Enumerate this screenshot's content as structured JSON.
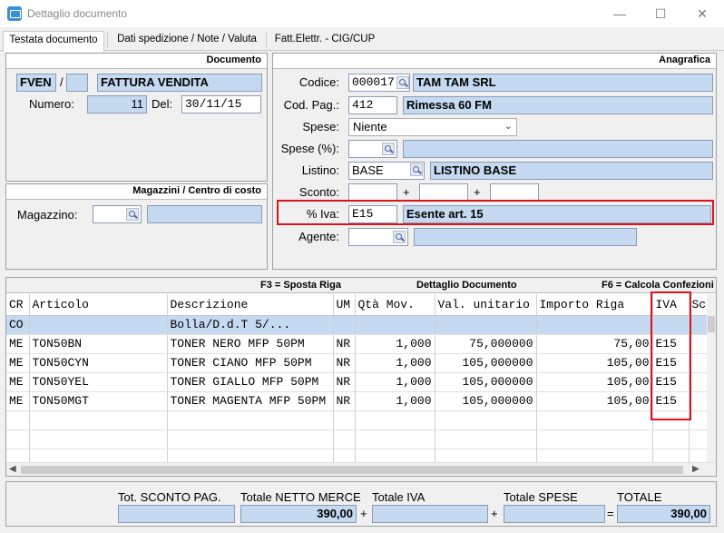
{
  "window": {
    "title": "Dettaglio documento",
    "controls": [
      "—",
      "☐",
      "✕"
    ]
  },
  "tabs": [
    {
      "label": "Testata documento",
      "active": true
    },
    {
      "label": "Dati spedizione / Note / Valuta",
      "active": false
    },
    {
      "label": "Fatt.Elettr. - CIG/CUP",
      "active": false
    }
  ],
  "documento": {
    "header": "Documento",
    "type_code": "FVEN",
    "separator": "/",
    "type_desc": "FATTURA VENDITA",
    "numero_label": "Numero:",
    "numero": "11",
    "del_label": "Del:",
    "del": "30/11/15"
  },
  "magazzini": {
    "header": "Magazzini / Centro di costo",
    "magazzino_label": "Magazzino:"
  },
  "anagrafica": {
    "header": "Anagrafica",
    "codice_label": "Codice:",
    "codice": "000017",
    "codice_desc": "TAM TAM SRL",
    "codpag_label": "Cod. Pag.:",
    "codpag": "412",
    "codpag_desc": "Rimessa 60 FM",
    "spese_label": "Spese:",
    "spese_value": "Niente",
    "spese_pct_label": "Spese (%):",
    "listino_label": "Listino:",
    "listino": "BASE",
    "listino_desc": "LISTINO BASE",
    "sconto_label": "Sconto:",
    "plus": "+",
    "iva_label": "% Iva:",
    "iva": "E15",
    "iva_desc": "Esente art. 15",
    "agente_label": "Agente:"
  },
  "grid": {
    "hint_left": "F3 = Sposta Riga",
    "title": "Dettaglio Documento",
    "hint_right": "F6 = Calcola Confezioni",
    "columns": [
      "CR",
      "Articolo",
      "Descrizione",
      "UM",
      "Qtà Mov.",
      "Val. unitario",
      "Importo Riga",
      "IVA",
      "Sc"
    ],
    "rows": [
      {
        "cr": "CO",
        "articolo": "",
        "descrizione": "Bolla/D.d.T       5/...",
        "um": "",
        "qta": "",
        "val": "",
        "importo": "",
        "iva": "",
        "selected": true
      },
      {
        "cr": "ME",
        "articolo": "TON50BN",
        "descrizione": "TONER NERO MFP 50PM",
        "um": "NR",
        "qta": "1,000",
        "val": "75,000000",
        "importo": "75,00",
        "iva": "E15",
        "selected": false
      },
      {
        "cr": "ME",
        "articolo": "TON50CYN",
        "descrizione": "TONER CIANO MFP 50PM",
        "um": "NR",
        "qta": "1,000",
        "val": "105,000000",
        "importo": "105,00",
        "iva": "E15",
        "selected": false
      },
      {
        "cr": "ME",
        "articolo": "TON50YEL",
        "descrizione": "TONER GIALLO MFP 50PM",
        "um": "NR",
        "qta": "1,000",
        "val": "105,000000",
        "importo": "105,00",
        "iva": "E15",
        "selected": false
      },
      {
        "cr": "ME",
        "articolo": "TON50MGT",
        "descrizione": "TONER MAGENTA MFP 50PM",
        "um": "NR",
        "qta": "1,000",
        "val": "105,000000",
        "importo": "105,00",
        "iva": "E15",
        "selected": false
      }
    ],
    "empty_rows": 3
  },
  "totali": {
    "sconto_pag_label": "Tot. SCONTO PAG.",
    "netto_label": "Totale NETTO MERCE",
    "netto": "390,00",
    "iva_label": "Totale IVA",
    "spese_label": "Totale SPESE",
    "totale_label": "TOTALE",
    "totale": "390,00",
    "plus": "+",
    "equals": "="
  },
  "colors": {
    "highlight": "#d8141d",
    "field_blue": "#c5d9f1"
  }
}
